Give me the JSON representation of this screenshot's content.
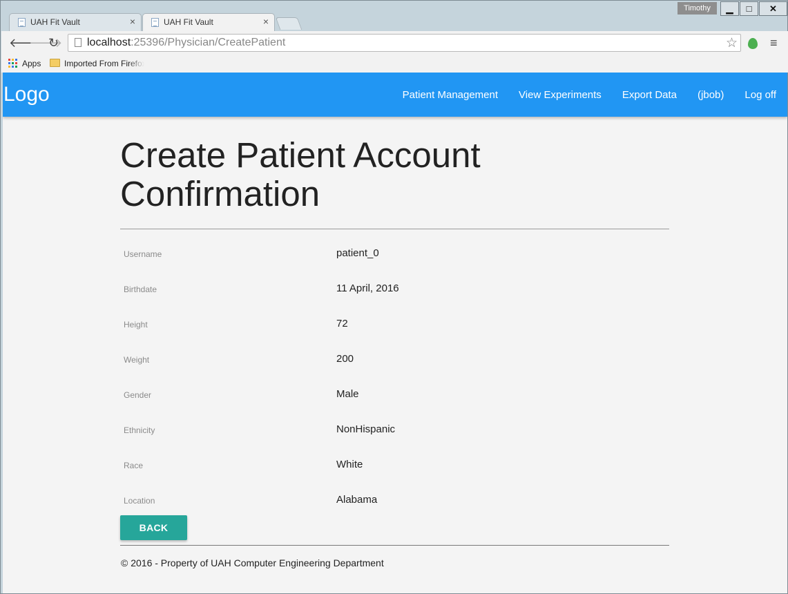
{
  "browser": {
    "tabs": [
      {
        "title": "UAH Fit Vault",
        "active": false
      },
      {
        "title": "UAH Fit Vault",
        "active": true
      }
    ],
    "profile_name": "Timothy",
    "window_controls": {
      "minimize": "▁",
      "maximize": "□",
      "close": "✕"
    },
    "url_host": "localhost",
    "url_rest": ":25396/Physician/CreatePatient",
    "bookmarks": {
      "apps": "Apps",
      "imported": "Imported From Firefox"
    },
    "apps_icon_colors": [
      "#e8453c",
      "#f9bb2d",
      "#3b78e7",
      "#3b78e7",
      "#0f9d58",
      "#e8453c",
      "#f9bb2d",
      "#3b78e7",
      "#0f9d58"
    ]
  },
  "navbar": {
    "logo": "Logo",
    "links": [
      "Patient Management",
      "View Experiments",
      "Export Data",
      "(jbob)",
      "Log off"
    ],
    "color": "#2196f3"
  },
  "page": {
    "title": "Create Patient Account Confirmation",
    "fields": [
      {
        "label": "Username",
        "value": "patient_0"
      },
      {
        "label": "Birthdate",
        "value": "11 April, 2016"
      },
      {
        "label": "Height",
        "value": "72"
      },
      {
        "label": "Weight",
        "value": "200"
      },
      {
        "label": "Gender",
        "value": "Male"
      },
      {
        "label": "Ethnicity",
        "value": "NonHispanic"
      },
      {
        "label": "Race",
        "value": "White"
      },
      {
        "label": "Location",
        "value": "Alabama"
      }
    ],
    "back_label": "BACK",
    "back_color": "#26a69a",
    "footer": "© 2016 - Property of UAH Computer Engineering Department"
  }
}
